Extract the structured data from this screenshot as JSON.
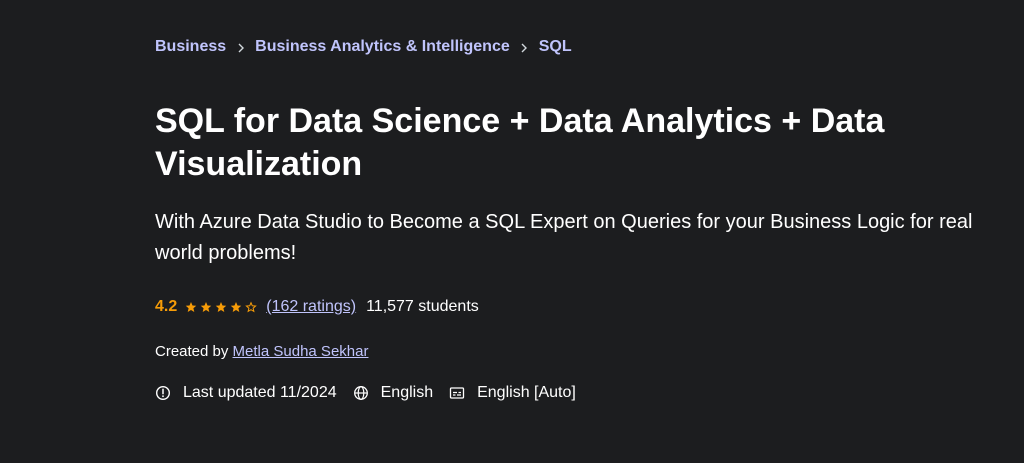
{
  "breadcrumb": {
    "items": [
      "Business",
      "Business Analytics & Intelligence",
      "SQL"
    ]
  },
  "course": {
    "title": "SQL for Data Science + Data Analytics + Data Visualization",
    "subtitle": "With Azure Data Studio to Become a SQL Expert on Queries for your Business Logic for real world problems!",
    "rating": "4.2",
    "stars_filled": 4,
    "stars_total": 5,
    "ratings_count": "(162 ratings)",
    "students": "11,577 students",
    "created_by_label": "Created by",
    "instructor": "Metla Sudha Sekhar",
    "last_updated": "Last updated 11/2024",
    "language": "English",
    "captions": "English [Auto]"
  },
  "colors": {
    "background": "#1c1d1f",
    "link": "#c0c4fc",
    "star": "#f69c08",
    "text": "#ffffff"
  },
  "icons": {
    "separator": "chevron-right-icon",
    "updated": "alert-clock-icon",
    "language": "globe-icon",
    "captions": "closed-captions-icon"
  }
}
